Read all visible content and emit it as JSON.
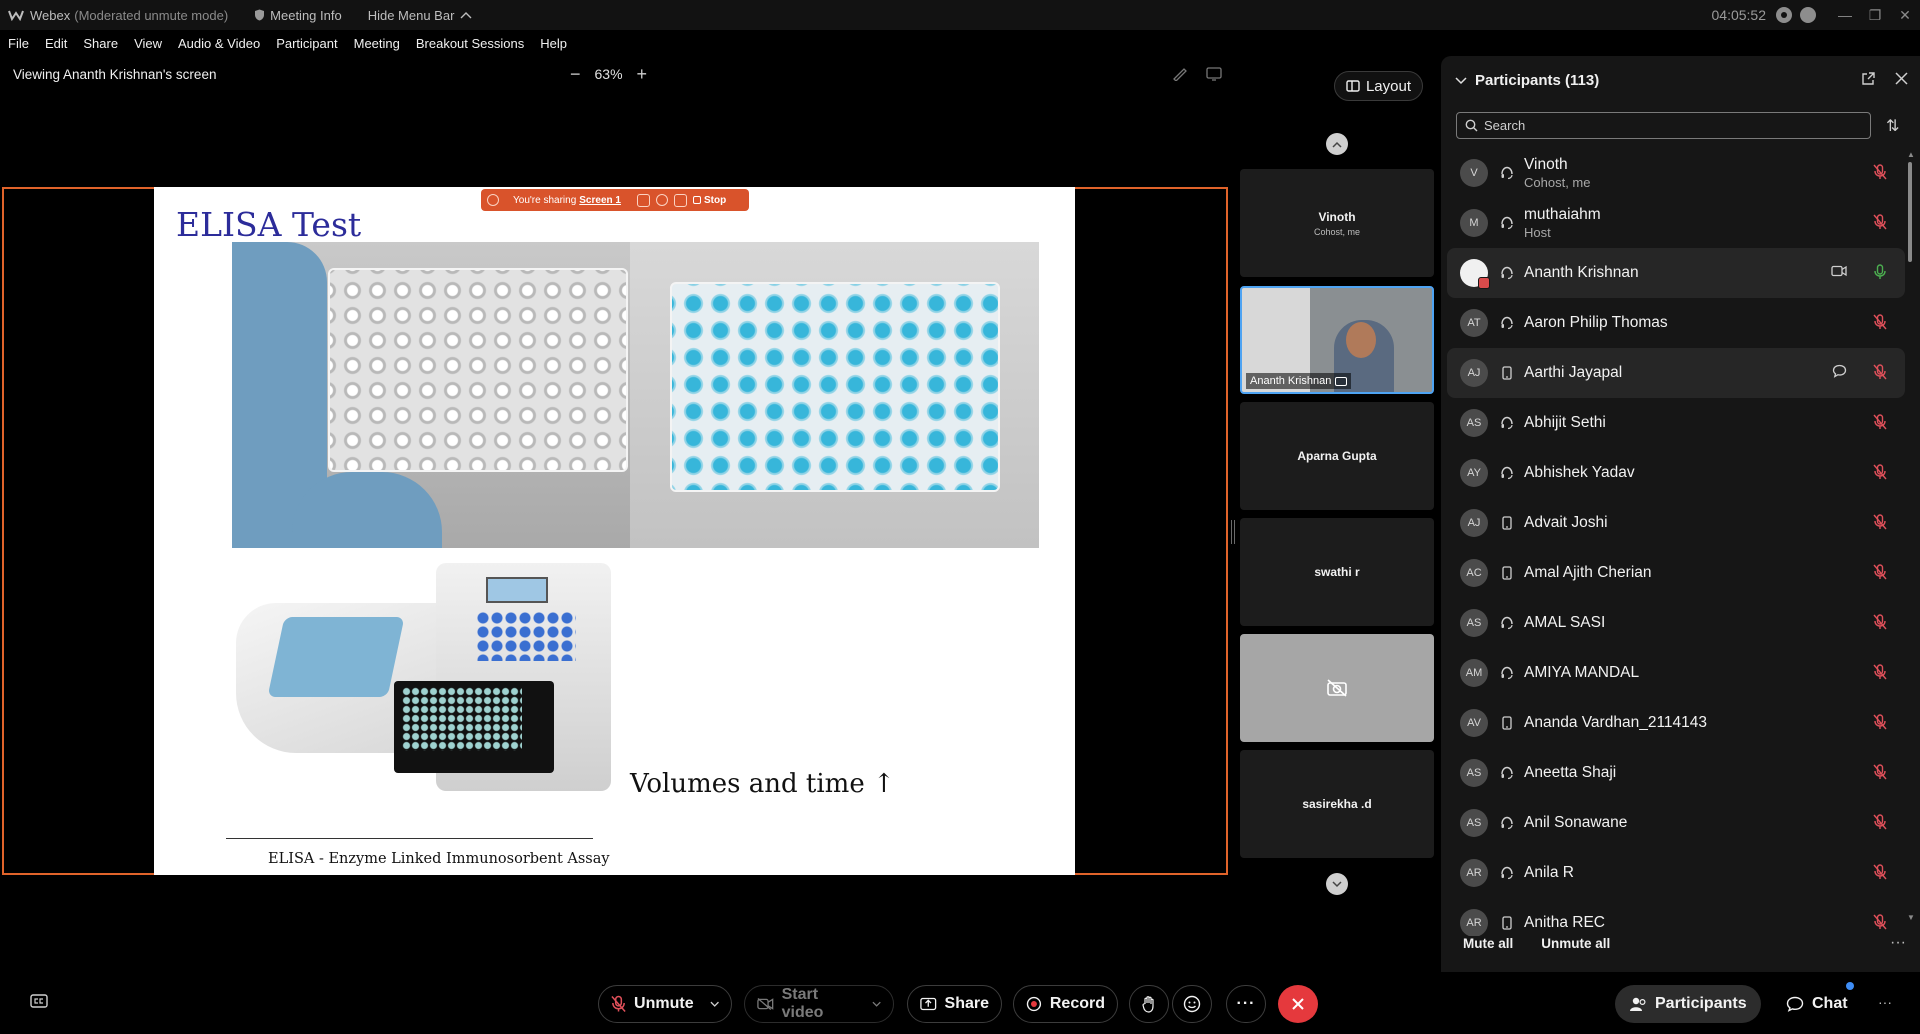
{
  "titlebar": {
    "app_name": "Webex",
    "mode": "(Moderated unmute mode)",
    "meeting_info": "Meeting Info",
    "hide_menu_bar": "Hide Menu Bar",
    "clock": "04:05:52"
  },
  "menu": {
    "items": [
      "File",
      "Edit",
      "Share",
      "View",
      "Audio & Video",
      "Participant",
      "Meeting",
      "Breakout Sessions",
      "Help"
    ]
  },
  "viewbar": {
    "viewing_text": "Viewing Ananth Krishnan's screen",
    "zoom_level": "63%"
  },
  "sharing_bar": {
    "text": "You're sharing",
    "screen": "Screen 1",
    "stop": "Stop"
  },
  "slide": {
    "title": "ELISA Test",
    "caption": "Volumes and time ↑",
    "footnote": "ELISA - Enzyme Linked Immunosorbent Assay"
  },
  "layout_button": "Layout",
  "tiles": [
    {
      "name": "Vinoth",
      "role": "Cohost, me"
    },
    {
      "name": "Ananth Krishnan",
      "role": ""
    },
    {
      "name": "Aparna Gupta",
      "role": ""
    },
    {
      "name": "swathi r",
      "role": ""
    },
    {
      "name": "",
      "role": ""
    },
    {
      "name": "sasirekha .d",
      "role": ""
    }
  ],
  "panel": {
    "title": "Participants (113)",
    "search_placeholder": "Search",
    "mute_all": "Mute all",
    "unmute_all": "Unmute all",
    "participants": [
      {
        "initials": "V",
        "name": "Vinoth",
        "role": "Cohost, me",
        "device": "headset",
        "mic": "muted"
      },
      {
        "initials": "M",
        "name": "muthaiahm",
        "role": "Host",
        "device": "headset",
        "mic": "muted"
      },
      {
        "initials": "",
        "name": "Ananth Krishnan",
        "role": "",
        "device": "headset",
        "mic": "active",
        "video": true
      },
      {
        "initials": "AT",
        "name": "Aaron Philip Thomas",
        "role": "",
        "device": "headset",
        "mic": "muted"
      },
      {
        "initials": "AJ",
        "name": "Aarthi Jayapal",
        "role": "",
        "device": "phone",
        "mic": "muted",
        "chat": true
      },
      {
        "initials": "AS",
        "name": "Abhijit Sethi",
        "role": "",
        "device": "headset",
        "mic": "muted"
      },
      {
        "initials": "AY",
        "name": "Abhishek Yadav",
        "role": "",
        "device": "headset",
        "mic": "muted"
      },
      {
        "initials": "AJ",
        "name": "Advait Joshi",
        "role": "",
        "device": "phone",
        "mic": "muted"
      },
      {
        "initials": "AC",
        "name": "Amal Ajith Cherian",
        "role": "",
        "device": "phone",
        "mic": "muted"
      },
      {
        "initials": "AS",
        "name": "AMAL SASI",
        "role": "",
        "device": "headset",
        "mic": "muted"
      },
      {
        "initials": "AM",
        "name": "AMIYA MANDAL",
        "role": "",
        "device": "headset",
        "mic": "muted"
      },
      {
        "initials": "AV",
        "name": "Ananda Vardhan_2114143",
        "role": "",
        "device": "phone",
        "mic": "muted"
      },
      {
        "initials": "AS",
        "name": "Aneetta Shaji",
        "role": "",
        "device": "headset",
        "mic": "muted"
      },
      {
        "initials": "AS",
        "name": "Anil Sonawane",
        "role": "",
        "device": "headset",
        "mic": "muted"
      },
      {
        "initials": "AR",
        "name": "Anila R",
        "role": "",
        "device": "headset",
        "mic": "muted"
      },
      {
        "initials": "AR",
        "name": "Anitha REC",
        "role": "",
        "device": "phone",
        "mic": "muted"
      }
    ]
  },
  "controls": {
    "unmute": "Unmute",
    "start_video": "Start video",
    "share": "Share",
    "record": "Record",
    "participants": "Participants",
    "chat": "Chat"
  },
  "colors": {
    "share_border": "#e0632a",
    "mic_muted": "#e0505a",
    "mic_active": "#4caf50",
    "end_call": "#e5393d",
    "video_tile_border": "#4ea3f2"
  }
}
